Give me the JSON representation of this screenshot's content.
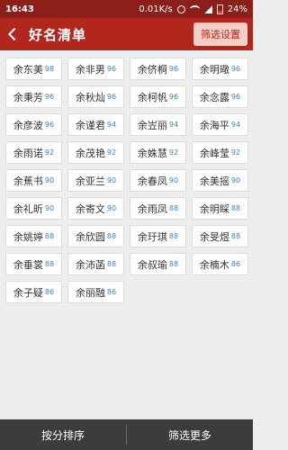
{
  "status": {
    "time": "16:43",
    "speed": "0.01K/s",
    "battery": "24%"
  },
  "header": {
    "title": "好名清单",
    "filter_button": "筛选设置"
  },
  "names": [
    {
      "name": "余东美",
      "score": "98"
    },
    {
      "name": "余非男",
      "score": "96"
    },
    {
      "name": "余侪桐",
      "score": "96"
    },
    {
      "name": "余明璥",
      "score": "96"
    },
    {
      "name": "余秉芳",
      "score": "96"
    },
    {
      "name": "余秋灿",
      "score": "96"
    },
    {
      "name": "余柯帆",
      "score": "96"
    },
    {
      "name": "余念露",
      "score": "96"
    },
    {
      "name": "余彦波",
      "score": "96"
    },
    {
      "name": "余谨君",
      "score": "94"
    },
    {
      "name": "余岦丽",
      "score": "94"
    },
    {
      "name": "余海平",
      "score": "94"
    },
    {
      "name": "余雨诺",
      "score": "92"
    },
    {
      "name": "余茂艳",
      "score": "92"
    },
    {
      "name": "余姝慧",
      "score": "92"
    },
    {
      "name": "余峰莹",
      "score": "92"
    },
    {
      "name": "余蕉书",
      "score": "90"
    },
    {
      "name": "余亚兰",
      "score": "90"
    },
    {
      "name": "余春凤",
      "score": "90"
    },
    {
      "name": "余美摇",
      "score": "90"
    },
    {
      "name": "余礼昕",
      "score": "90"
    },
    {
      "name": "余寄文",
      "score": "90"
    },
    {
      "name": "余雨凤",
      "score": "88"
    },
    {
      "name": "余明睬",
      "score": "88"
    },
    {
      "name": "余姚婷",
      "score": "88"
    },
    {
      "name": "余欣圆",
      "score": "88"
    },
    {
      "name": "余玗琪",
      "score": "88"
    },
    {
      "name": "余旻煜",
      "score": "88"
    },
    {
      "name": "余垂裳",
      "score": "88"
    },
    {
      "name": "余沛菡",
      "score": "88"
    },
    {
      "name": "余叔瑜",
      "score": "88"
    },
    {
      "name": "余楠木",
      "score": "86"
    },
    {
      "name": "余子疑",
      "score": "86"
    },
    {
      "name": "余丽融",
      "score": "86"
    }
  ],
  "bottom": {
    "sort_label": "按分排序",
    "more_label": "筛选更多"
  }
}
